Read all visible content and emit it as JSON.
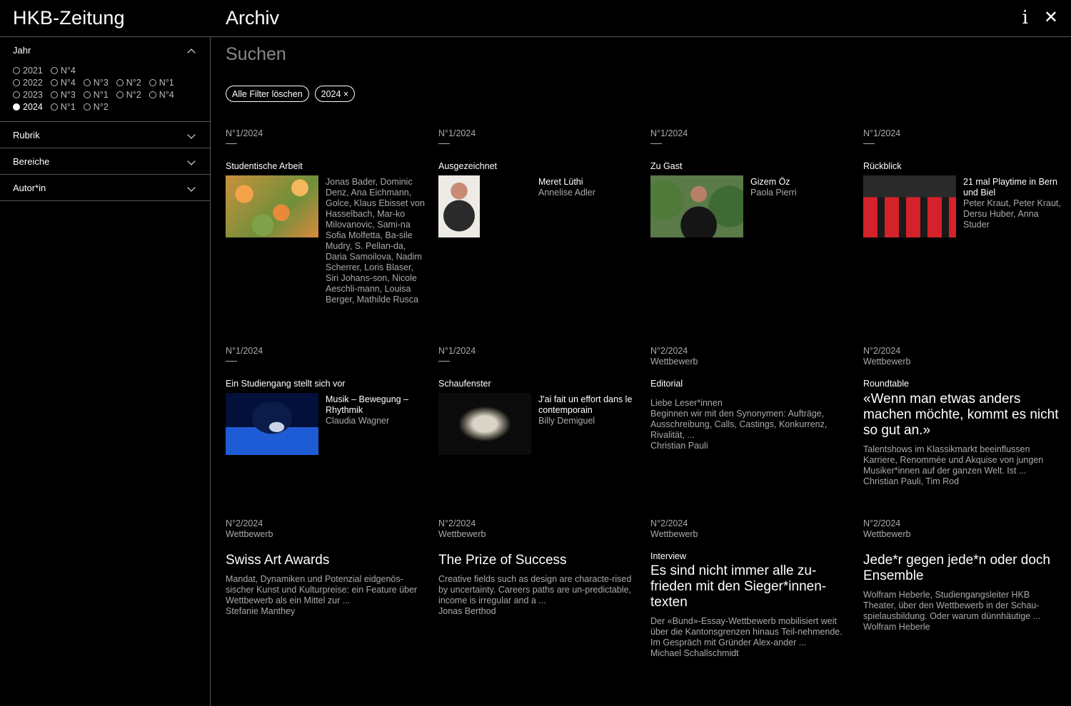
{
  "header": {
    "brand": "HKB-Zeitung",
    "title": "Archiv"
  },
  "sidebar": {
    "year_filter": {
      "label": "Jahr",
      "rows": [
        {
          "year": "2021",
          "issues": [
            "N°4"
          ]
        },
        {
          "year": "2022",
          "issues": [
            "N°4",
            "N°3",
            "N°2",
            "N°1"
          ]
        },
        {
          "year": "2023",
          "issues": [
            "N°3",
            "N°1",
            "N°2",
            "N°4"
          ]
        },
        {
          "year": "2024",
          "issues": [
            "N°1",
            "N°2"
          ],
          "selected": true
        }
      ]
    },
    "sections": [
      {
        "label": "Rubrik"
      },
      {
        "label": "Bereiche"
      },
      {
        "label": "Autor*in"
      }
    ]
  },
  "search": {
    "placeholder": "Suchen"
  },
  "chips": {
    "clear": "Alle Filter löschen",
    "year": "2024 ×"
  },
  "cards": [
    {
      "issue": "N°1/2024",
      "rubrik": "Studentische Arbeit",
      "title": "",
      "authors": "Jonas Bader, Dominic Denz, Ana Eichmann, Golce, Klaus Ebisset von Hasselbach, Mar-ko Milovanovic, Sami-na Sofia Molfetta, Ba-sile Mudry, S. Pellan-da, Daria Samoilova, Nadim Scherrer, Loris Blaser, Siri Johans-son, Nicole Aeschli-mann, Louisa Berger, Mathilde Rusca"
    },
    {
      "issue": "N°1/2024",
      "rubrik": "Ausgezeichnet",
      "title": "Meret Lüthi",
      "authors": "Annelise Adler"
    },
    {
      "issue": "N°1/2024",
      "rubrik": "Zu Gast",
      "title": "Gizem Öz",
      "authors": "Paola Pierri"
    },
    {
      "issue": "N°1/2024",
      "rubrik": "Rückblick",
      "title": "21 mal Playtime in Bern und Biel",
      "authors": "Peter Kraut, Peter Kraut, Dersu Huber, Anna Studer"
    },
    {
      "issue": "N°1/2024",
      "rubrik": "Ein Studiengang stellt sich vor",
      "title": "Musik – Bewegung – Rhythmik",
      "authors": "Claudia Wagner"
    },
    {
      "issue": "N°1/2024",
      "rubrik": "Schaufenster",
      "title": "J'ai fait un effort dans le contemporain",
      "authors": "Billy Demiguel"
    },
    {
      "issue": "N°2/2024",
      "sub": "Wettbewerb",
      "rubrik": "Editorial",
      "title": "Liebe Leser*innen",
      "teaser": "Beginnen wir mit den Synonymen: Aufträge, Ausschreibung, Calls, Castings, Konkurrenz, Rivalität, ...",
      "authors": "Christian Pauli"
    },
    {
      "issue": "N°2/2024",
      "sub": "Wettbewerb",
      "rubrik": "Roundtable",
      "title": "«Wenn man etwas anders machen möchte, kommt es nicht so gut an.»",
      "teaser": "Talentshows im Klassikmarkt beeinflussen Karriere, Renommée und Akquise von jungen Musiker*innen auf der ganzen Welt. Ist ...",
      "authors": "Christian Pauli, Tim Rod"
    },
    {
      "issue": "N°2/2024",
      "sub": "Wettbewerb",
      "rubrik": "",
      "title": "Swiss Art Awards",
      "teaser": "Mandat, Dynamiken und Potenzial eidgenös-sischer Kunst und Kulturpreise: ein Feature über Wettbewerb als ein Mittel zur ...",
      "authors": "Stefanie Manthey"
    },
    {
      "issue": "N°2/2024",
      "sub": "Wettbewerb",
      "rubrik": "",
      "title": "The Prize of Success",
      "teaser": "Creative fields such as design are characte-rised by uncertainty. Careers paths are un-predictable, income is irregular and a ...",
      "authors": "Jonas Berthod"
    },
    {
      "issue": "N°2/2024",
      "sub": "Wettbewerb",
      "rubrik": "Interview",
      "title": "Es sind nicht immer alle zu-frieden mit den Sieger*innen-texten",
      "teaser": "Der «Bund»-Essay-Wettbewerb mobilisiert weit über die Kantonsgrenzen hinaus Teil-nehmende. Im Gespräch mit Gründer Alex-ander ...",
      "authors": "Michael Schallschmidt"
    },
    {
      "issue": "N°2/2024",
      "sub": "Wettbewerb",
      "rubrik": "",
      "title": "Jede*r gegen jede*n oder doch Ensemble",
      "teaser": "Wolfram Heberle, Studiengangsleiter HKB Theater, über den Wettbewerb in der Schau-spielausbildung. Oder warum dünnhäutige ...",
      "authors": "Wolfram Heberle"
    }
  ],
  "colors": {
    "background": "#000000",
    "text": "#ffffff",
    "muted": "#aaaaaa",
    "border": "#555555"
  }
}
